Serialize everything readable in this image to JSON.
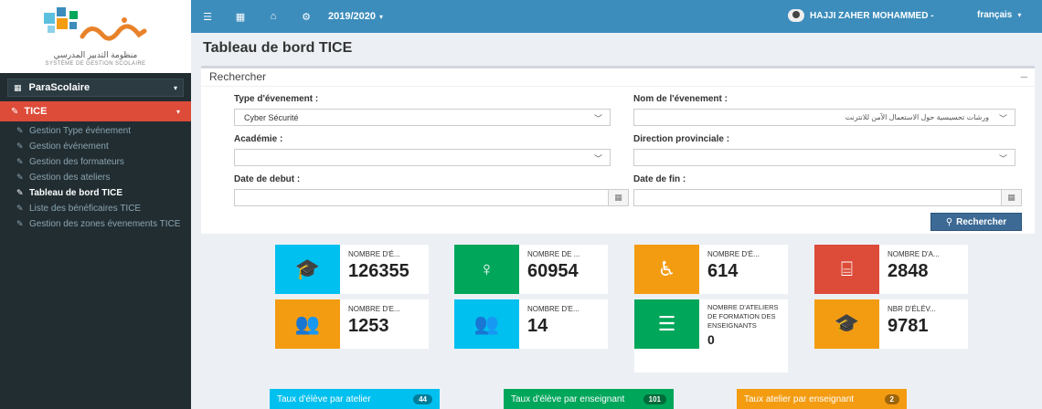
{
  "logo": {
    "wordmark": "مسار",
    "arabic_subtitle": "منظومة التدبير المدرسي",
    "french_subtitle": "SYSTÈME DE GESTION SCOLAIRE"
  },
  "sidebar": {
    "para_scolaire": "ParaScolaire",
    "tice": "TICE",
    "items": [
      {
        "label": "Gestion Type événement"
      },
      {
        "label": "Gestion événement"
      },
      {
        "label": "Gestion des formateurs"
      },
      {
        "label": "Gestion des ateliers"
      },
      {
        "label": "Tableau de bord TICE"
      },
      {
        "label": "Liste des bénéficaires TICE"
      },
      {
        "label": "Gestion des zones évenements TICE"
      }
    ],
    "active_index": 4
  },
  "topbar": {
    "year": "2019/2020",
    "user": "HAJJI ZAHER MOHAMMED -",
    "language": "français"
  },
  "page": {
    "title": "Tableau de bord TICE"
  },
  "search": {
    "header": "Rechercher",
    "collapse_symbol": "–",
    "type_label": "Type d'évenement :",
    "type_value": "Cyber Sécurité",
    "nom_label": "Nom de l'évenement :",
    "nom_value": "ورشات تحسيسية حول الاستعمال الآمن للانترنت",
    "academie_label": "Académie :",
    "academie_value": "",
    "direction_label": "Direction provinciale :",
    "direction_value": "",
    "date_debut_label": "Date de debut :",
    "date_debut_value": "",
    "date_fin_label": "Date de fin :",
    "date_fin_value": "",
    "button": "Rechercher"
  },
  "stats": [
    {
      "text": "NOMBRE D'É...",
      "number": "126355",
      "color": "#00c0ef",
      "icon": "graduation-cap-icon"
    },
    {
      "text": "NOMBRE DE ...",
      "number": "60954",
      "color": "#00a65a",
      "icon": "female-icon"
    },
    {
      "text": "NOMBRE D'É...",
      "number": "614",
      "color": "#f39c12",
      "icon": "wheelchair-icon"
    },
    {
      "text": "NOMBRE D'A...",
      "number": "2848",
      "color": "#dd4b39",
      "icon": "easel-icon"
    },
    {
      "text": "NOMBRE D'E...",
      "number": "1253",
      "color": "#f39c12",
      "icon": "users-icon"
    },
    {
      "text": "NOMBRE D'E...",
      "number": "14",
      "color": "#00c0ef",
      "icon": "users-icon"
    },
    {
      "text": "NOMBRE D'ATELIERS DE FORMATION DES ENSEIGNANTS",
      "number": "0",
      "color": "#00a65a",
      "icon": "server-icon"
    },
    {
      "text": "NBR D'ÉLÉV...",
      "number": "9781",
      "color": "#f39c12",
      "icon": "graduation-cap-icon"
    }
  ],
  "rates": [
    {
      "label": "Taux d'élève par atelier",
      "value": "44",
      "color": "#00c0ef"
    },
    {
      "label": "Taux d'élève par enseignant",
      "value": "101",
      "color": "#00a65a"
    },
    {
      "label": "Taux atelier par enseignant",
      "value": "2",
      "color": "#f39c12"
    }
  ]
}
